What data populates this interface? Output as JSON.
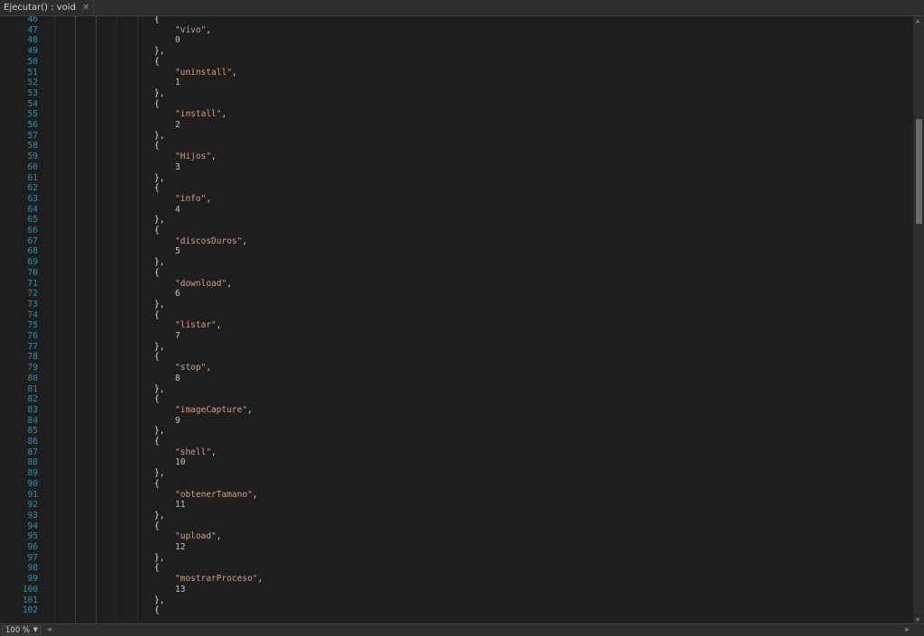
{
  "tab": {
    "title": "Ejecutar() : void",
    "close_glyph": "✕"
  },
  "statusbar": {
    "zoom": "100 %"
  },
  "editor": {
    "lines": [
      {
        "n": "46",
        "type": "open"
      },
      {
        "n": "47",
        "type": "str",
        "text": "\"vivo\""
      },
      {
        "n": "48",
        "type": "num",
        "text": "0"
      },
      {
        "n": "49",
        "type": "close"
      },
      {
        "n": "50",
        "type": "open"
      },
      {
        "n": "51",
        "type": "str",
        "text": "\"uninstall\""
      },
      {
        "n": "52",
        "type": "num",
        "text": "1"
      },
      {
        "n": "53",
        "type": "close"
      },
      {
        "n": "54",
        "type": "open"
      },
      {
        "n": "55",
        "type": "str",
        "text": "\"install\""
      },
      {
        "n": "56",
        "type": "num",
        "text": "2"
      },
      {
        "n": "57",
        "type": "close"
      },
      {
        "n": "58",
        "type": "open"
      },
      {
        "n": "59",
        "type": "str",
        "text": "\"Hijos\""
      },
      {
        "n": "60",
        "type": "num",
        "text": "3"
      },
      {
        "n": "61",
        "type": "close"
      },
      {
        "n": "62",
        "type": "open"
      },
      {
        "n": "63",
        "type": "str",
        "text": "\"info\""
      },
      {
        "n": "64",
        "type": "num",
        "text": "4"
      },
      {
        "n": "65",
        "type": "close"
      },
      {
        "n": "66",
        "type": "open"
      },
      {
        "n": "67",
        "type": "str",
        "text": "\"discosDuros\""
      },
      {
        "n": "68",
        "type": "num",
        "text": "5"
      },
      {
        "n": "69",
        "type": "close"
      },
      {
        "n": "70",
        "type": "open"
      },
      {
        "n": "71",
        "type": "str",
        "text": "\"download\""
      },
      {
        "n": "72",
        "type": "num",
        "text": "6"
      },
      {
        "n": "73",
        "type": "close"
      },
      {
        "n": "74",
        "type": "open"
      },
      {
        "n": "75",
        "type": "str",
        "text": "\"listar\""
      },
      {
        "n": "76",
        "type": "num",
        "text": "7"
      },
      {
        "n": "77",
        "type": "close"
      },
      {
        "n": "78",
        "type": "open"
      },
      {
        "n": "79",
        "type": "str",
        "text": "\"stop\""
      },
      {
        "n": "80",
        "type": "num",
        "text": "8"
      },
      {
        "n": "81",
        "type": "close"
      },
      {
        "n": "82",
        "type": "open"
      },
      {
        "n": "83",
        "type": "str",
        "text": "\"imageCapture\""
      },
      {
        "n": "84",
        "type": "num",
        "text": "9"
      },
      {
        "n": "85",
        "type": "close"
      },
      {
        "n": "86",
        "type": "open"
      },
      {
        "n": "87",
        "type": "str",
        "text": "\"shell\""
      },
      {
        "n": "88",
        "type": "num",
        "text": "10"
      },
      {
        "n": "89",
        "type": "close"
      },
      {
        "n": "90",
        "type": "open"
      },
      {
        "n": "91",
        "type": "str",
        "text": "\"obtenerTamano\""
      },
      {
        "n": "92",
        "type": "num",
        "text": "11"
      },
      {
        "n": "93",
        "type": "close"
      },
      {
        "n": "94",
        "type": "open"
      },
      {
        "n": "95",
        "type": "str",
        "text": "\"upload\""
      },
      {
        "n": "96",
        "type": "num",
        "text": "12"
      },
      {
        "n": "97",
        "type": "close"
      },
      {
        "n": "98",
        "type": "open"
      },
      {
        "n": "99",
        "type": "str",
        "text": "\"mostrarProceso\""
      },
      {
        "n": "100",
        "type": "num",
        "text": "13"
      },
      {
        "n": "101",
        "type": "close"
      },
      {
        "n": "102",
        "type": "open"
      }
    ]
  },
  "colors": {
    "line_number": "#2b91af",
    "string": "#d69d85",
    "number": "#b5cea8",
    "punctuation": "#dcdcdc",
    "background": "#1e1e1e"
  }
}
